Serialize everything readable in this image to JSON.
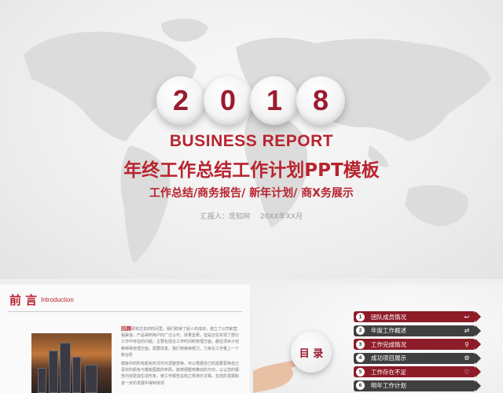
{
  "hero": {
    "digits": [
      "2",
      "0",
      "1",
      "8"
    ],
    "business_report": "BUSINESS REPORT",
    "main_title": "年终工作总结工作计划PPT模板",
    "subtitle": "工作总结/商务报告/ 新年计划/ 商X务展示",
    "reporter": "汇报人：觅知网",
    "date": "20XX年XX月"
  },
  "preface": {
    "title": "前 言",
    "title_en": "Introduction",
    "highlight": "回顾",
    "para1": "即将过去的时间里，我们取得了骄人的成绩，建立了公司和营销渠道，产品得到用户的广泛认可，效果显著，但是还在实现了部分工作中存在的问题，主要包括在工作时间和管理方面，都在项目计划等特殊管理方面，需要改善，我们将继续努力，力争在工作量上一个新台阶",
    "para2": "模板中的所有颜色形式均可调整替换，可以根据自己的需要更换自己喜欢的颜色与模板图案的布局，能够把握到推动的方向，以让您的报告内容更加生动形象，使工作报告总结之类演示文稿，在您的发展和进一步的发展中得到体现"
  },
  "toc": {
    "title": "目 录",
    "items": [
      {
        "num": "1",
        "label": "团队成员情况",
        "icon": "↩"
      },
      {
        "num": "2",
        "label": "年度工作概述",
        "icon": "⇄"
      },
      {
        "num": "3",
        "label": "工作完成情况",
        "icon": "⚲"
      },
      {
        "num": "4",
        "label": "成功项目展示",
        "icon": "⚙"
      },
      {
        "num": "5",
        "label": "工作存在不足",
        "icon": "♡"
      },
      {
        "num": "6",
        "label": "明年工作计划",
        "icon": ""
      }
    ]
  },
  "colors": {
    "accent": "#b8242f",
    "dark_red": "#8e1b28",
    "dark_gray": "#3f3f3f"
  }
}
